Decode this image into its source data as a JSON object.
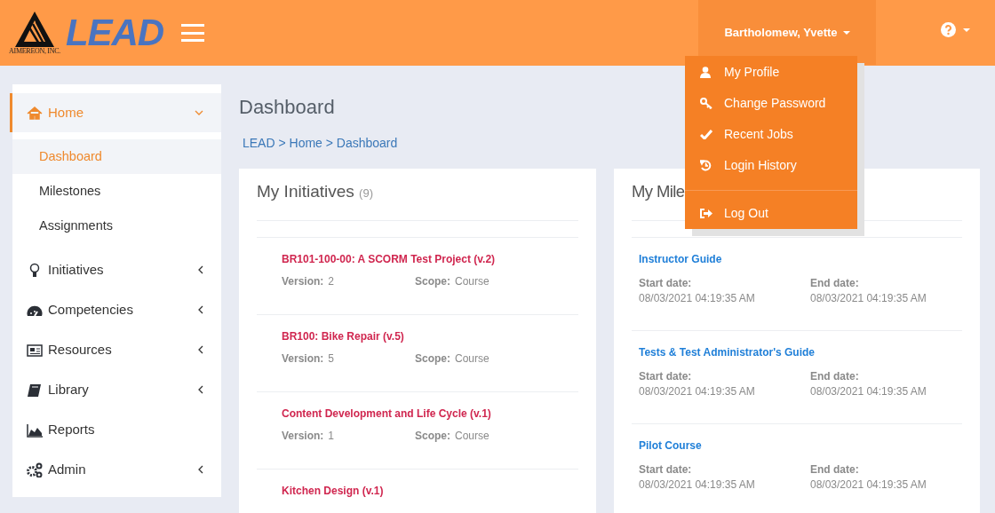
{
  "header": {
    "logo_caption": "AIMEREON, INC.",
    "logo_text": "LEAD",
    "user_name": "Bartholomew, Yvette",
    "user_menu_open": true
  },
  "user_menu": [
    {
      "kind": "profile",
      "label": "My Profile"
    },
    {
      "kind": "password",
      "label": "Change Password"
    },
    {
      "kind": "jobs",
      "label": "Recent Jobs"
    },
    {
      "kind": "history",
      "label": "Login History"
    },
    {
      "kind": "logout",
      "label": "Log Out"
    }
  ],
  "sidebar": {
    "items": [
      {
        "kind": "home",
        "label": "Home",
        "selected": true,
        "expanded": true,
        "children": [
          {
            "label": "Dashboard",
            "selected": true
          },
          {
            "label": "Milestones",
            "selected": false
          },
          {
            "label": "Assignments",
            "selected": false
          }
        ]
      },
      {
        "kind": "bulb",
        "label": "Initiatives",
        "selected": false,
        "expanded": false
      },
      {
        "kind": "gauge",
        "label": "Competencies",
        "selected": false,
        "expanded": false
      },
      {
        "kind": "news",
        "label": "Resources",
        "selected": false,
        "expanded": false
      },
      {
        "kind": "book",
        "label": "Library",
        "selected": false,
        "expanded": false
      },
      {
        "kind": "chart",
        "label": "Reports",
        "selected": false
      },
      {
        "kind": "cogs",
        "label": "Admin",
        "selected": false,
        "expanded": false
      }
    ]
  },
  "page_title": "Dashboard",
  "breadcrumb": "LEAD > Home > Dashboard",
  "initiatives": {
    "title": "My Initiatives",
    "count": "(9)",
    "items": [
      {
        "name": "BR101-100-00: A SCORM Test Project (v.2)",
        "version_label": "Version:",
        "version": "2",
        "scope_label": "Scope:",
        "scope": "Course"
      },
      {
        "name": "BR100: Bike Repair (v.5)",
        "version_label": "Version:",
        "version": "5",
        "scope_label": "Scope:",
        "scope": "Course"
      },
      {
        "name": "Content Development and Life Cycle (v.1)",
        "version_label": "Version:",
        "version": "1",
        "scope_label": "Scope:",
        "scope": "Course"
      },
      {
        "name": "Kitchen Design (v.1)"
      }
    ]
  },
  "milestones": {
    "title": "My Mile",
    "items": [
      {
        "name": "Instructor Guide",
        "start_label": "Start date:",
        "start": "08/03/2021 04:19:35 AM",
        "end_label": "End date:",
        "end": "08/03/2021 04:19:35 AM"
      },
      {
        "name": "Tests & Test Administrator's Guide",
        "start_label": "Start date:",
        "start": "08/03/2021 04:19:35 AM",
        "end_label": "End date:",
        "end": "08/03/2021 04:19:35 AM"
      },
      {
        "name": "Pilot Course",
        "start_label": "Start date:",
        "start": "08/03/2021 04:19:35 AM",
        "end_label": "End date:",
        "end": "08/03/2021 04:19:35 AM"
      }
    ]
  }
}
